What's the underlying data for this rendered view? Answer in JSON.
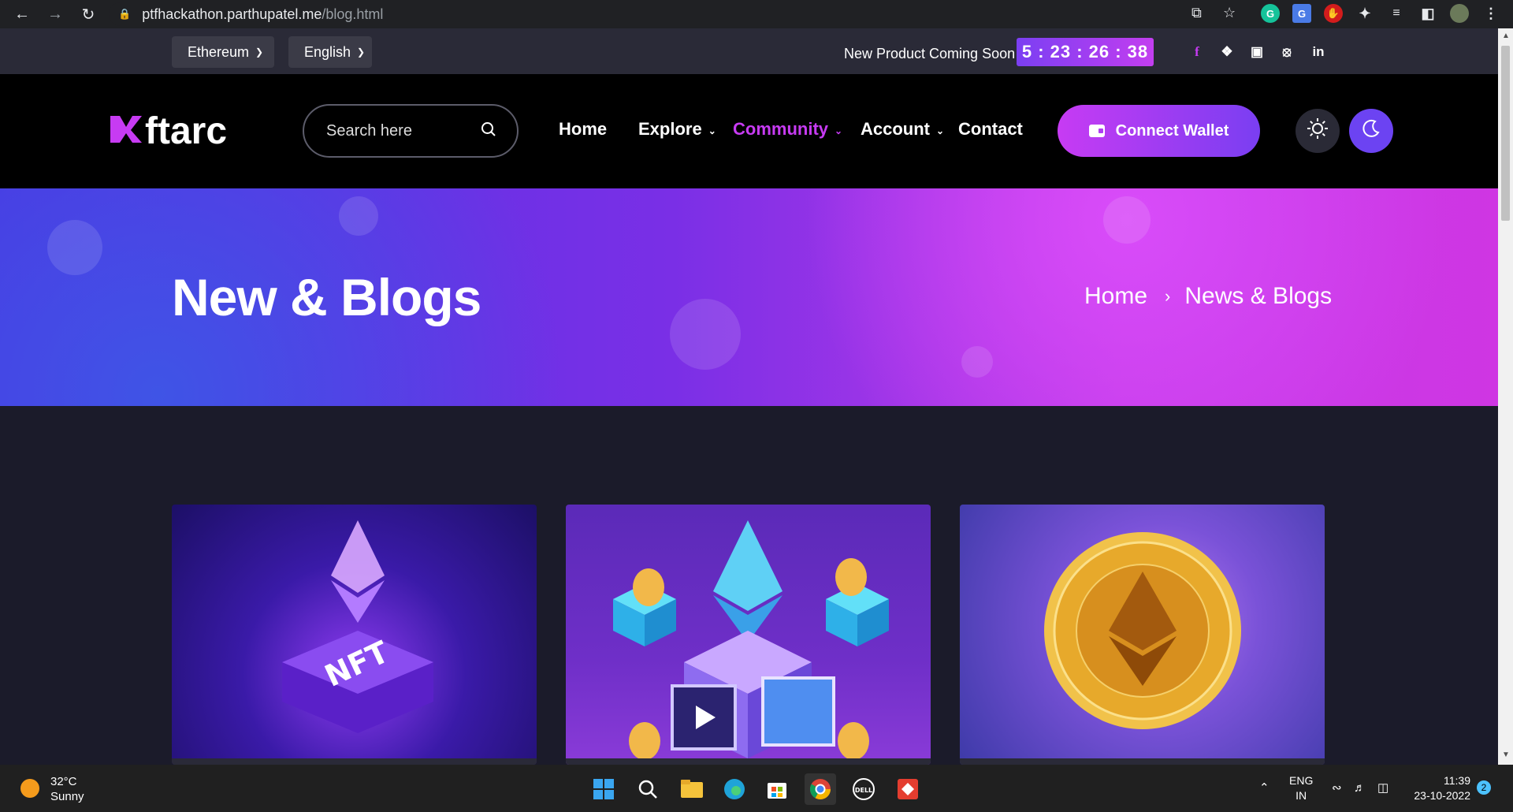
{
  "browser": {
    "url_host": "ptfhackathon.parthupatel.me",
    "url_path": "/blog.html"
  },
  "topbar": {
    "currency": "Ethereum",
    "language": "English",
    "announcement": "New Product Coming Soon",
    "countdown": "5 : 23 : 26 : 38",
    "social_icons": [
      "facebook-icon",
      "twitter-icon",
      "instagram-icon",
      "dribbble-icon",
      "linkedin-icon"
    ]
  },
  "header": {
    "logo_text": "ftarc",
    "search_placeholder": "Search here",
    "menu": [
      {
        "label": "Home",
        "has_dropdown": false,
        "active": false
      },
      {
        "label": "Explore",
        "has_dropdown": true,
        "active": false
      },
      {
        "label": "Community",
        "has_dropdown": true,
        "active": true
      },
      {
        "label": "Account",
        "has_dropdown": true,
        "active": false
      },
      {
        "label": "Contact",
        "has_dropdown": false,
        "active": false
      }
    ],
    "connect_label": "Connect Wallet",
    "accent_color": "#c73bf3"
  },
  "banner": {
    "title": "New & Blogs",
    "breadcrumb_home": "Home",
    "breadcrumb_current": "News & Blogs"
  },
  "cards": [
    {
      "image": "nft-ethereum-hexagon-image"
    },
    {
      "image": "ethereum-isometric-blocks-image"
    },
    {
      "image": "gold-ethereum-coin-image"
    }
  ],
  "taskbar": {
    "weather_temp": "32°C",
    "weather_desc": "Sunny",
    "lang_top": "ENG",
    "lang_bottom": "IN",
    "time": "11:39",
    "date": "23-10-2022",
    "notification_count": "2"
  }
}
